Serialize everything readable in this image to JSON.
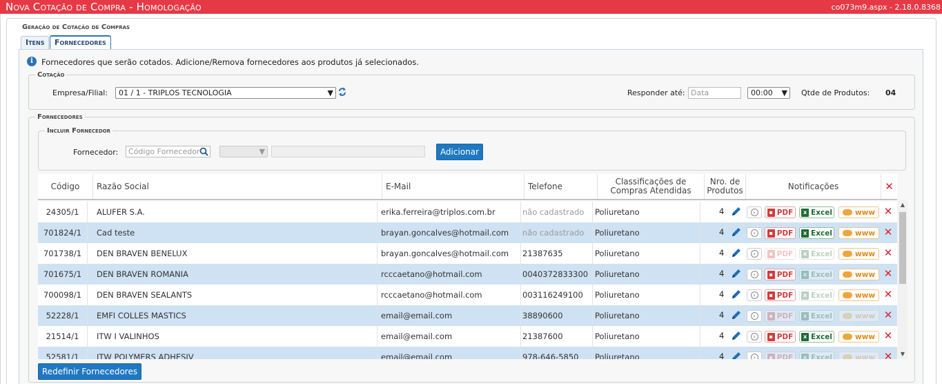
{
  "window": {
    "title": "Nova Cotação de Compra - Homologação",
    "version": "co073m9.aspx - 2.18.0.8368"
  },
  "panel": {
    "legend": "Geração de Cotação de Compras"
  },
  "tabs": [
    {
      "label": "Itens",
      "active": false
    },
    {
      "label": "Fornecedores",
      "active": true
    }
  ],
  "info": {
    "icon": "info-icon",
    "text": "Fornecedores que serão cotados. Adicione/Remova fornecedores aos produtos já selecionados."
  },
  "cotacao": {
    "legend": "Cotação",
    "empresa_label": "Empresa/Filial:",
    "empresa_value": "01 / 1 - TRIPLOS TECNOLOGIA",
    "responder_label": "Responder até:",
    "data_placeholder": "Data",
    "hora_value": "00:00",
    "qtde_label": "Qtde de Produtos:",
    "qtde_value": "04"
  },
  "fornecedores": {
    "legend": "Fornecedores",
    "incluir_legend": "Incluir Fornecedor",
    "fornecedor_label": "Fornecedor:",
    "codigo_placeholder": "Código Fornecedor",
    "adicionar_label": "Adicionar"
  },
  "table": {
    "headers": {
      "codigo": "Código",
      "razao": "Razão Social",
      "email": "E-Mail",
      "telefone": "Telefone",
      "classificacoes": "Classificações de Compras Atendidas",
      "nro": "Nro. de Produtos",
      "notificacoes": "Notificações"
    },
    "badge_labels": {
      "pdf": "PDF",
      "excel": "Excel",
      "www": "www"
    },
    "rows": [
      {
        "codigo": "24305/1",
        "razao": "ALUFER S.A.",
        "email": "erika.ferreira@triplos.com.br",
        "telefone": "não cadastrado",
        "classificacao": "Poliuretano",
        "nro": "4",
        "pdf": true,
        "excel": true,
        "www": true
      },
      {
        "codigo": "701824/1",
        "razao": "Cad teste",
        "email": "brayan.goncalves@hotmail.com",
        "telefone": "não cadastrado",
        "classificacao": "Poliuretano",
        "nro": "4",
        "pdf": true,
        "excel": true,
        "www": true
      },
      {
        "codigo": "701738/1",
        "razao": "DEN BRAVEN BENELUX",
        "email": "brayan.goncalves@hotmail.com",
        "telefone": "21387635",
        "classificacao": "Poliuretano",
        "nro": "4",
        "pdf": false,
        "excel": false,
        "www": true
      },
      {
        "codigo": "701675/1",
        "razao": "DEN BRAVEN ROMANIA",
        "email": "rcccaetano@hotmail.com",
        "telefone": "0040372833300",
        "classificacao": "Poliuretano",
        "nro": "4",
        "pdf": true,
        "excel": false,
        "www": true
      },
      {
        "codigo": "700098/1",
        "razao": "DEN BRAVEN SEALANTS",
        "email": "rcccaetano@hotmail.com",
        "telefone": "003116249100",
        "classificacao": "Poliuretano",
        "nro": "4",
        "pdf": true,
        "excel": false,
        "www": true
      },
      {
        "codigo": "52228/1",
        "razao": "EMFI COLLES MASTICS",
        "email": "email@email.com",
        "telefone": "38890600",
        "classificacao": "Poliuretano",
        "nro": "4",
        "pdf": false,
        "excel": false,
        "www": false
      },
      {
        "codigo": "21514/1",
        "razao": "ITW I VALINHOS",
        "email": "email@email.com",
        "telefone": "21387600",
        "classificacao": "Poliuretano",
        "nro": "4",
        "pdf": true,
        "excel": true,
        "www": true
      },
      {
        "codigo": "52581/1",
        "razao": "ITW POLYMERS ADHESIV",
        "email": "email@email.com",
        "telefone": "978-646-5850",
        "classificacao": "Poliuretano",
        "nro": "4",
        "pdf": false,
        "excel": false,
        "www": false
      }
    ]
  },
  "footer": {
    "redefinir_label": "Redefinir Fornecedores"
  }
}
